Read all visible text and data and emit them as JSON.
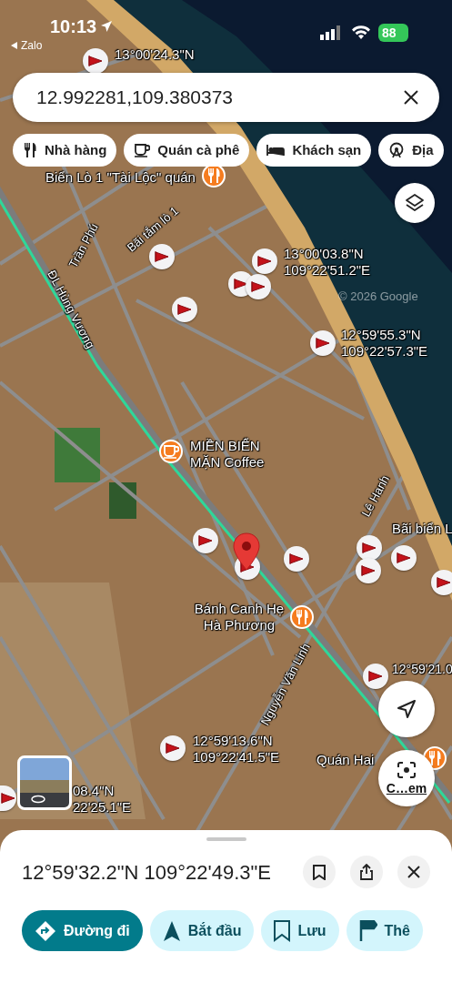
{
  "status_bar": {
    "time": "10:13",
    "back_app": "Zalo",
    "battery": "88"
  },
  "search": {
    "value": "12.992281,109.380373"
  },
  "chips": [
    {
      "kind": "restaurant",
      "label": "Nhà hàng"
    },
    {
      "kind": "cafe",
      "label": "Quán cà phê"
    },
    {
      "kind": "hotel",
      "label": "Khách sạn"
    },
    {
      "kind": "attraction",
      "label": "Địa"
    }
  ],
  "map": {
    "places": [
      {
        "kind": "restaurant",
        "name": "Biển Lò 1 \"Tài Lộc\" quán"
      },
      {
        "kind": "cafe",
        "name": "MIỀN BIỂN MẶN Coffee"
      },
      {
        "kind": "restaurant",
        "name": "Bánh Canh Hẹ Hà Phương"
      },
      {
        "kind": "none",
        "name": "Bãi biển L"
      },
      {
        "kind": "restaurant",
        "name": "Quán Hai"
      }
    ],
    "streets": [
      "ĐL Hùng Vương",
      "Trần Phú",
      "Bãi tắm lò 1",
      "Lê Hanh",
      "Nguyễn Văn Linh"
    ],
    "saved_pins": [
      {
        "lines": [
          "13°00'24.3\"N"
        ]
      },
      {
        "lines": [
          "13°00'03.8\"N",
          "109°22'51.2\"E"
        ]
      },
      {
        "lines": [
          "12°59'55.3\"N",
          "109°22'57.3\"E"
        ]
      },
      {
        "lines": [
          "12°59'21.0"
        ]
      },
      {
        "lines": [
          "12°59'13.6\"N",
          "109°22'41.5\"E"
        ]
      },
      {
        "lines": [
          "08.4\"N",
          "22'25.1\"E"
        ]
      }
    ],
    "attribution": "© 2026 Google"
  },
  "lens_button": {
    "label": "C…em"
  },
  "place_sheet": {
    "title": "12°59'32.2\"N 109°22'49.3\"E",
    "actions": [
      {
        "kind": "directions",
        "label": "Đường đi",
        "primary": true
      },
      {
        "kind": "start",
        "label": "Bắt đầu",
        "primary": false
      },
      {
        "kind": "save",
        "label": "Lưu",
        "primary": false
      },
      {
        "kind": "flag",
        "label": "Thê",
        "primary": false
      }
    ]
  }
}
